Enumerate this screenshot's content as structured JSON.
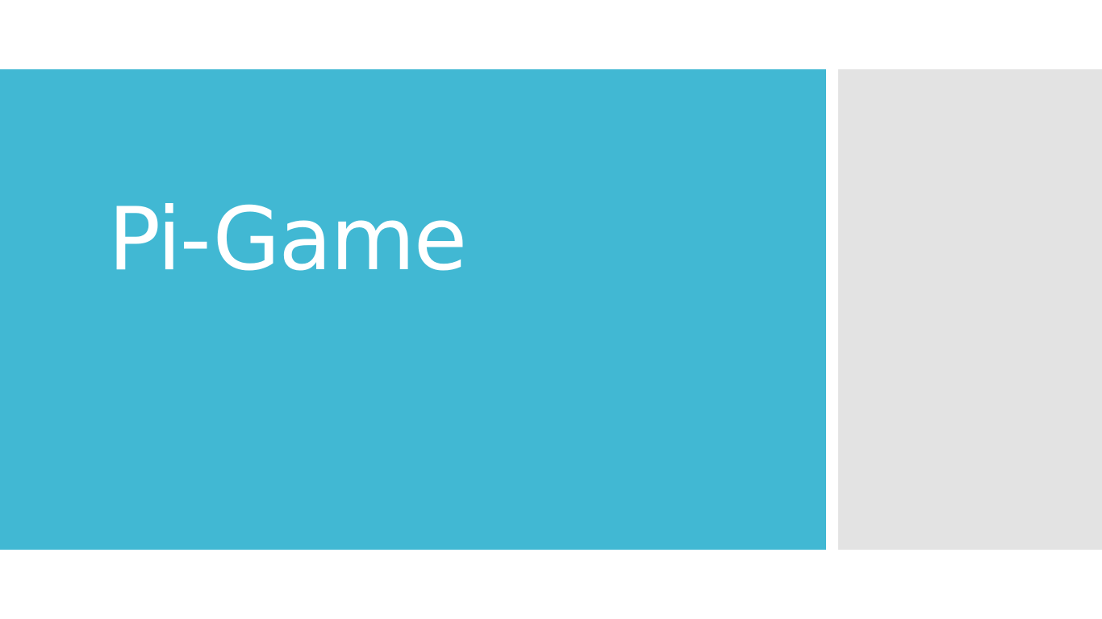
{
  "slide": {
    "title": "Pi-Game"
  },
  "colors": {
    "title_panel": "#41B8D3",
    "side_panel": "#E3E3E3",
    "background": "#FFFFFF",
    "title_text": "#FFFFFF"
  }
}
